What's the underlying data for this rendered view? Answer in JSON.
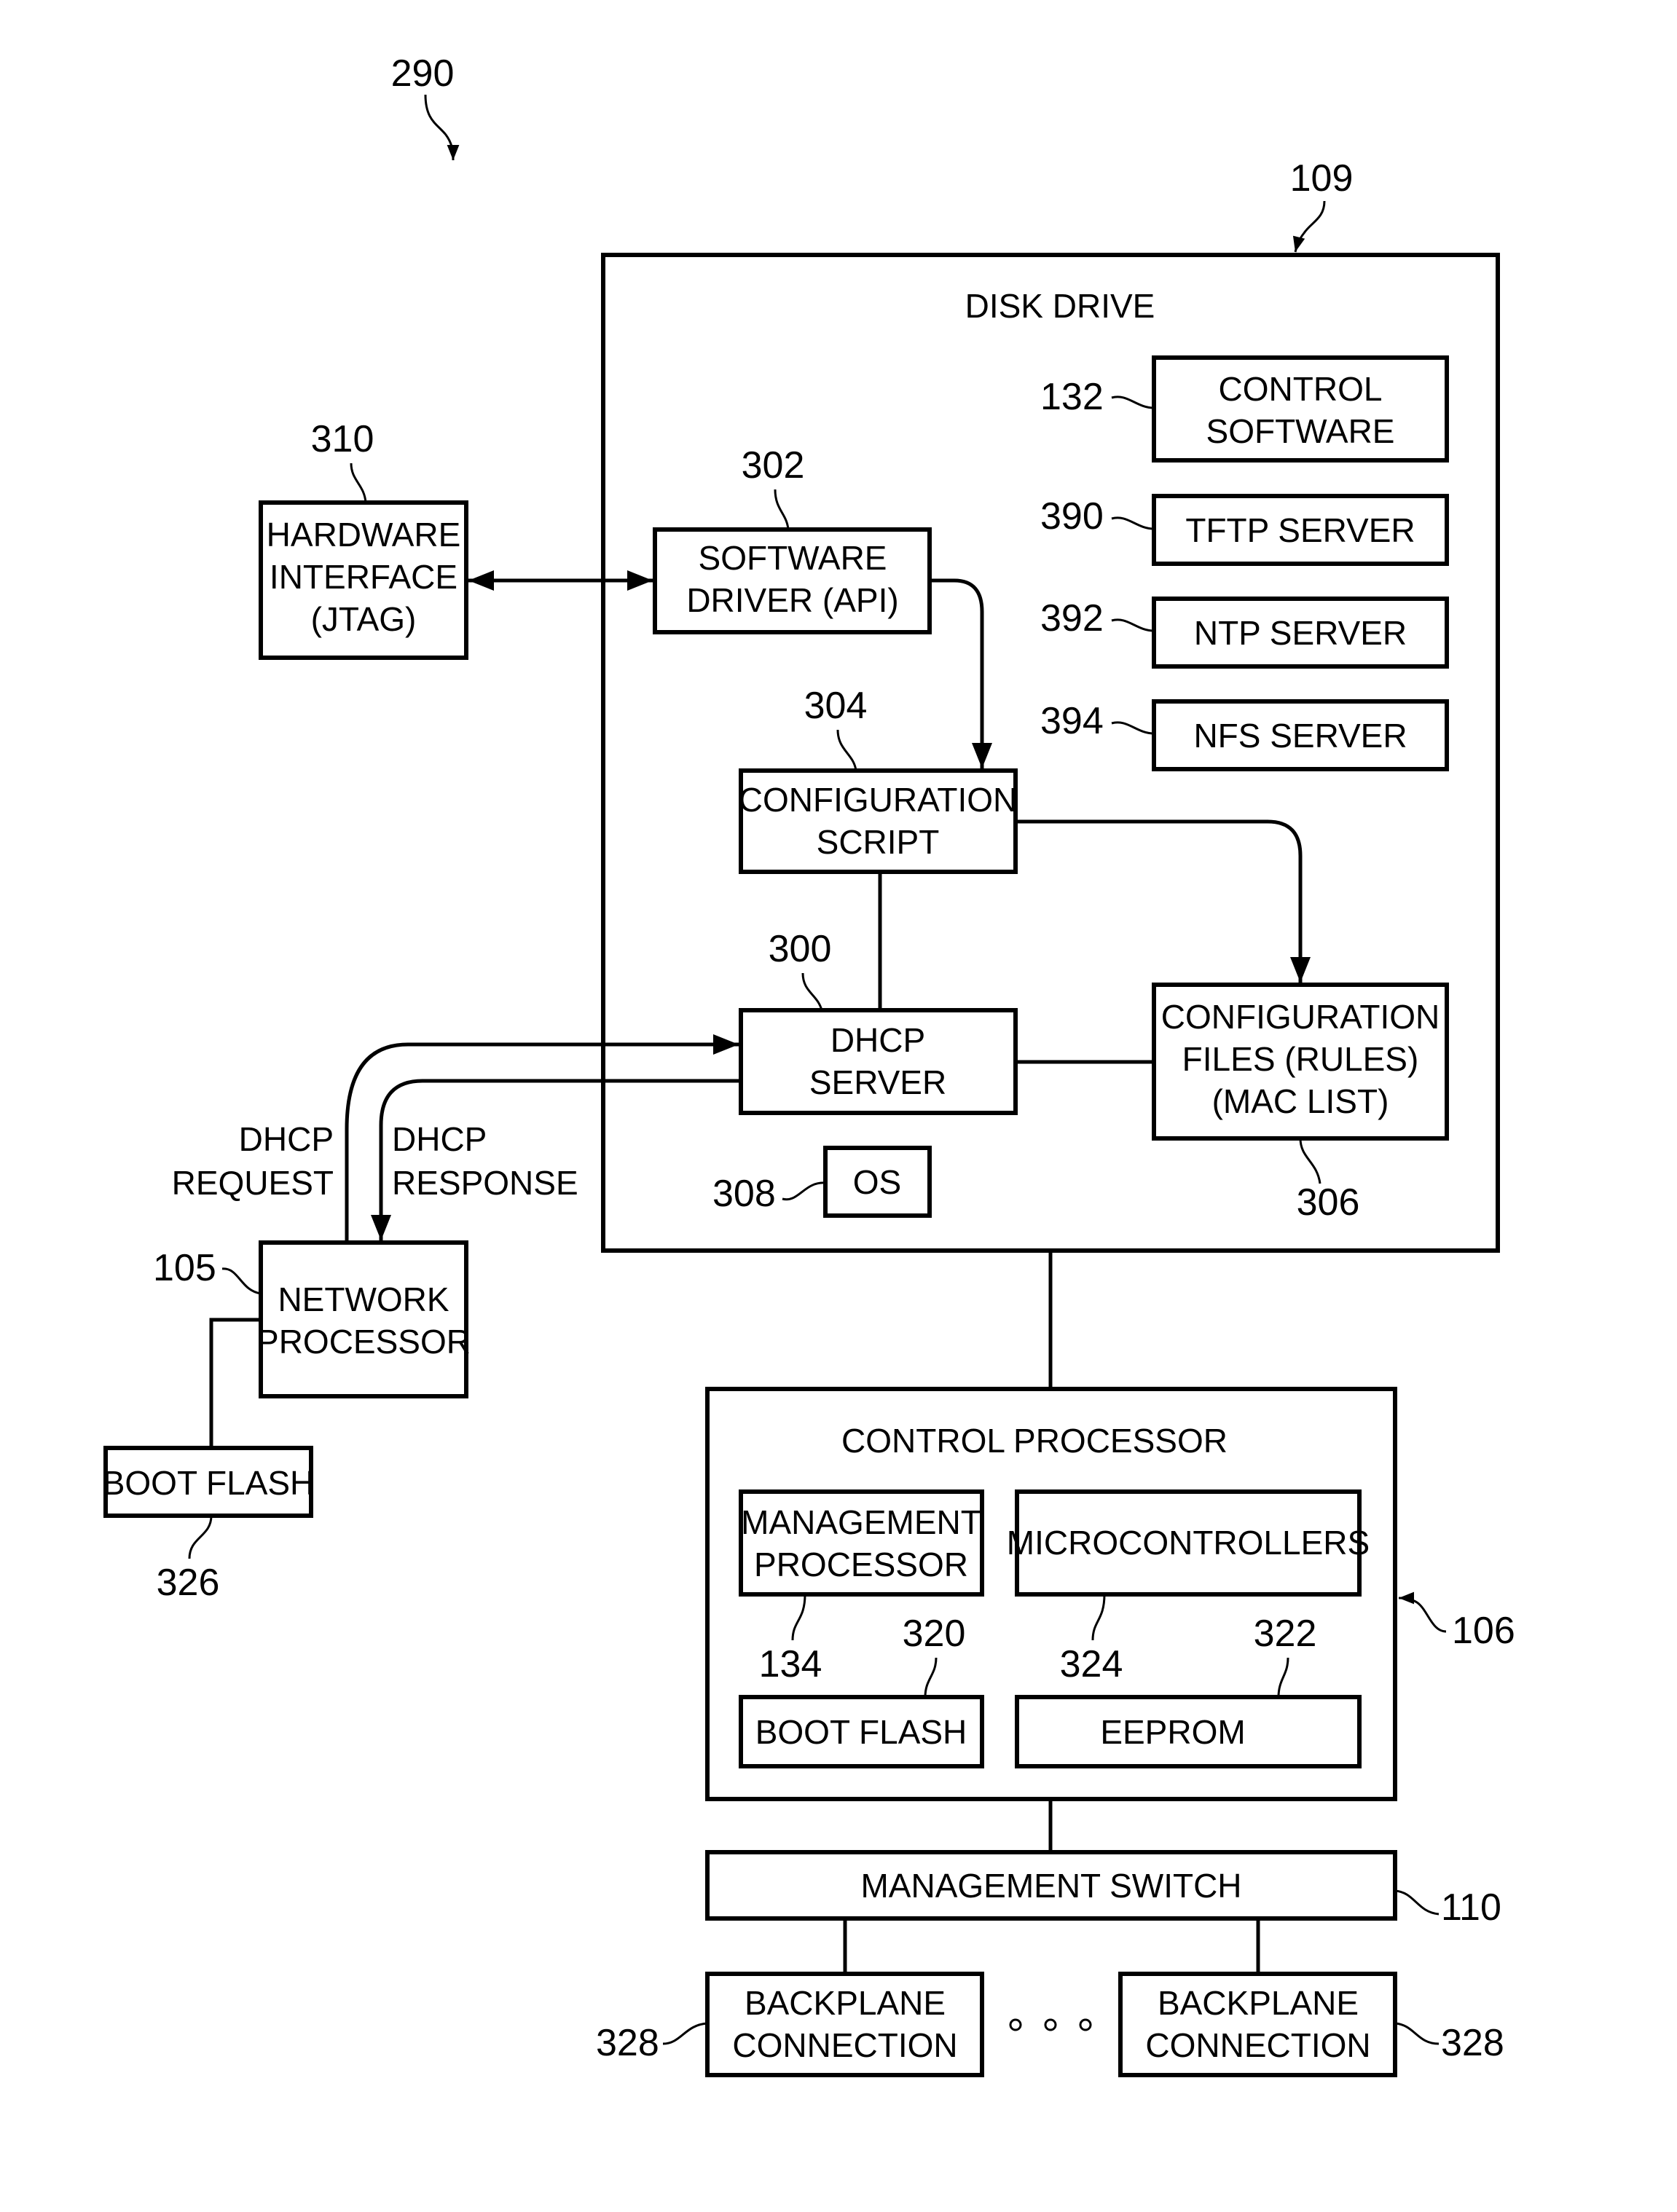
{
  "figure": {
    "ref": "290",
    "disk_drive": {
      "ref": "109",
      "title": "DISK DRIVE",
      "control_software": {
        "ref": "132",
        "lines": [
          "CONTROL",
          "SOFTWARE"
        ]
      },
      "tftp_server": {
        "ref": "390",
        "lines": [
          "TFTP SERVER"
        ]
      },
      "ntp_server": {
        "ref": "392",
        "lines": [
          "NTP SERVER"
        ]
      },
      "nfs_server": {
        "ref": "394",
        "lines": [
          "NFS SERVER"
        ]
      },
      "software_driver": {
        "ref": "302",
        "lines": [
          "SOFTWARE",
          "DRIVER (API)"
        ]
      },
      "configuration_script": {
        "ref": "304",
        "lines": [
          "CONFIGURATION",
          "SCRIPT"
        ]
      },
      "dhcp_server": {
        "ref": "300",
        "lines": [
          "DHCP",
          "SERVER"
        ]
      },
      "configuration_files": {
        "ref": "306",
        "lines": [
          "CONFIGURATION",
          "FILES (RULES)",
          "(MAC LIST)"
        ]
      },
      "os": {
        "ref": "308",
        "lines": [
          "OS"
        ]
      }
    },
    "hardware_interface": {
      "ref": "310",
      "lines": [
        "HARDWARE",
        "INTERFACE",
        "(JTAG)"
      ]
    },
    "network_processor": {
      "ref": "105",
      "lines": [
        "NETWORK",
        "PROCESSOR"
      ]
    },
    "boot_flash_external": {
      "ref": "326",
      "lines": [
        "BOOT FLASH"
      ]
    },
    "dhcp_request_label": [
      "DHCP",
      "REQUEST"
    ],
    "dhcp_response_label": [
      "DHCP",
      "RESPONSE"
    ],
    "control_processor": {
      "ref": "106",
      "title": "CONTROL PROCESSOR",
      "management_processor": {
        "ref": "134",
        "lines": [
          "MANAGEMENT",
          "PROCESSOR"
        ]
      },
      "microcontrollers": {
        "ref": "324",
        "lines": [
          "MICROCONTROLLERS"
        ]
      },
      "boot_flash": {
        "ref": "320",
        "lines": [
          "BOOT FLASH"
        ]
      },
      "eeprom": {
        "ref": "322",
        "lines": [
          "EEPROM"
        ]
      }
    },
    "management_switch": {
      "ref": "110",
      "lines": [
        "MANAGEMENT SWITCH"
      ]
    },
    "backplane_left": {
      "ref": "328",
      "lines": [
        "BACKPLANE",
        "CONNECTION"
      ]
    },
    "backplane_right": {
      "ref": "328",
      "lines": [
        "BACKPLANE",
        "CONNECTION"
      ]
    },
    "ellipsis": "o o o"
  }
}
